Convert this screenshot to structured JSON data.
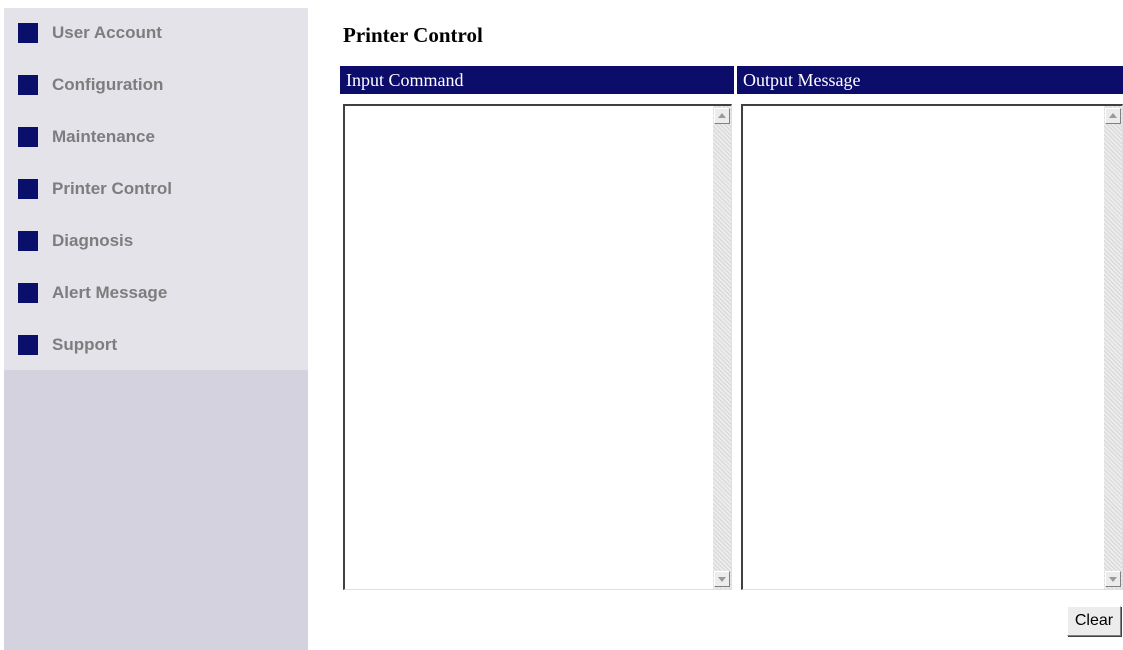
{
  "sidebar": {
    "items": [
      {
        "label": "User Account",
        "icon": "square-bullet-icon"
      },
      {
        "label": "Configuration",
        "icon": "square-bullet-icon"
      },
      {
        "label": "Maintenance",
        "icon": "square-bullet-icon"
      },
      {
        "label": "Printer Control",
        "icon": "square-bullet-icon"
      },
      {
        "label": "Diagnosis",
        "icon": "square-bullet-icon"
      },
      {
        "label": "Alert Message",
        "icon": "square-bullet-icon"
      },
      {
        "label": "Support",
        "icon": "square-bullet-icon"
      }
    ]
  },
  "main": {
    "title": "Printer Control",
    "input_panel": {
      "header": "Input Command",
      "value": ""
    },
    "output_panel": {
      "header": "Output Message",
      "value": ""
    },
    "clear_label": "Clear"
  },
  "colors": {
    "sidebar_menu_bg": "#e4e3ea",
    "sidebar_bg": "#d3d2de",
    "bullet": "#0b0f6c",
    "sidebar_text": "#7d7d7d",
    "panel_header_bg": "#0c0c6b",
    "panel_header_text": "#ffffff"
  }
}
